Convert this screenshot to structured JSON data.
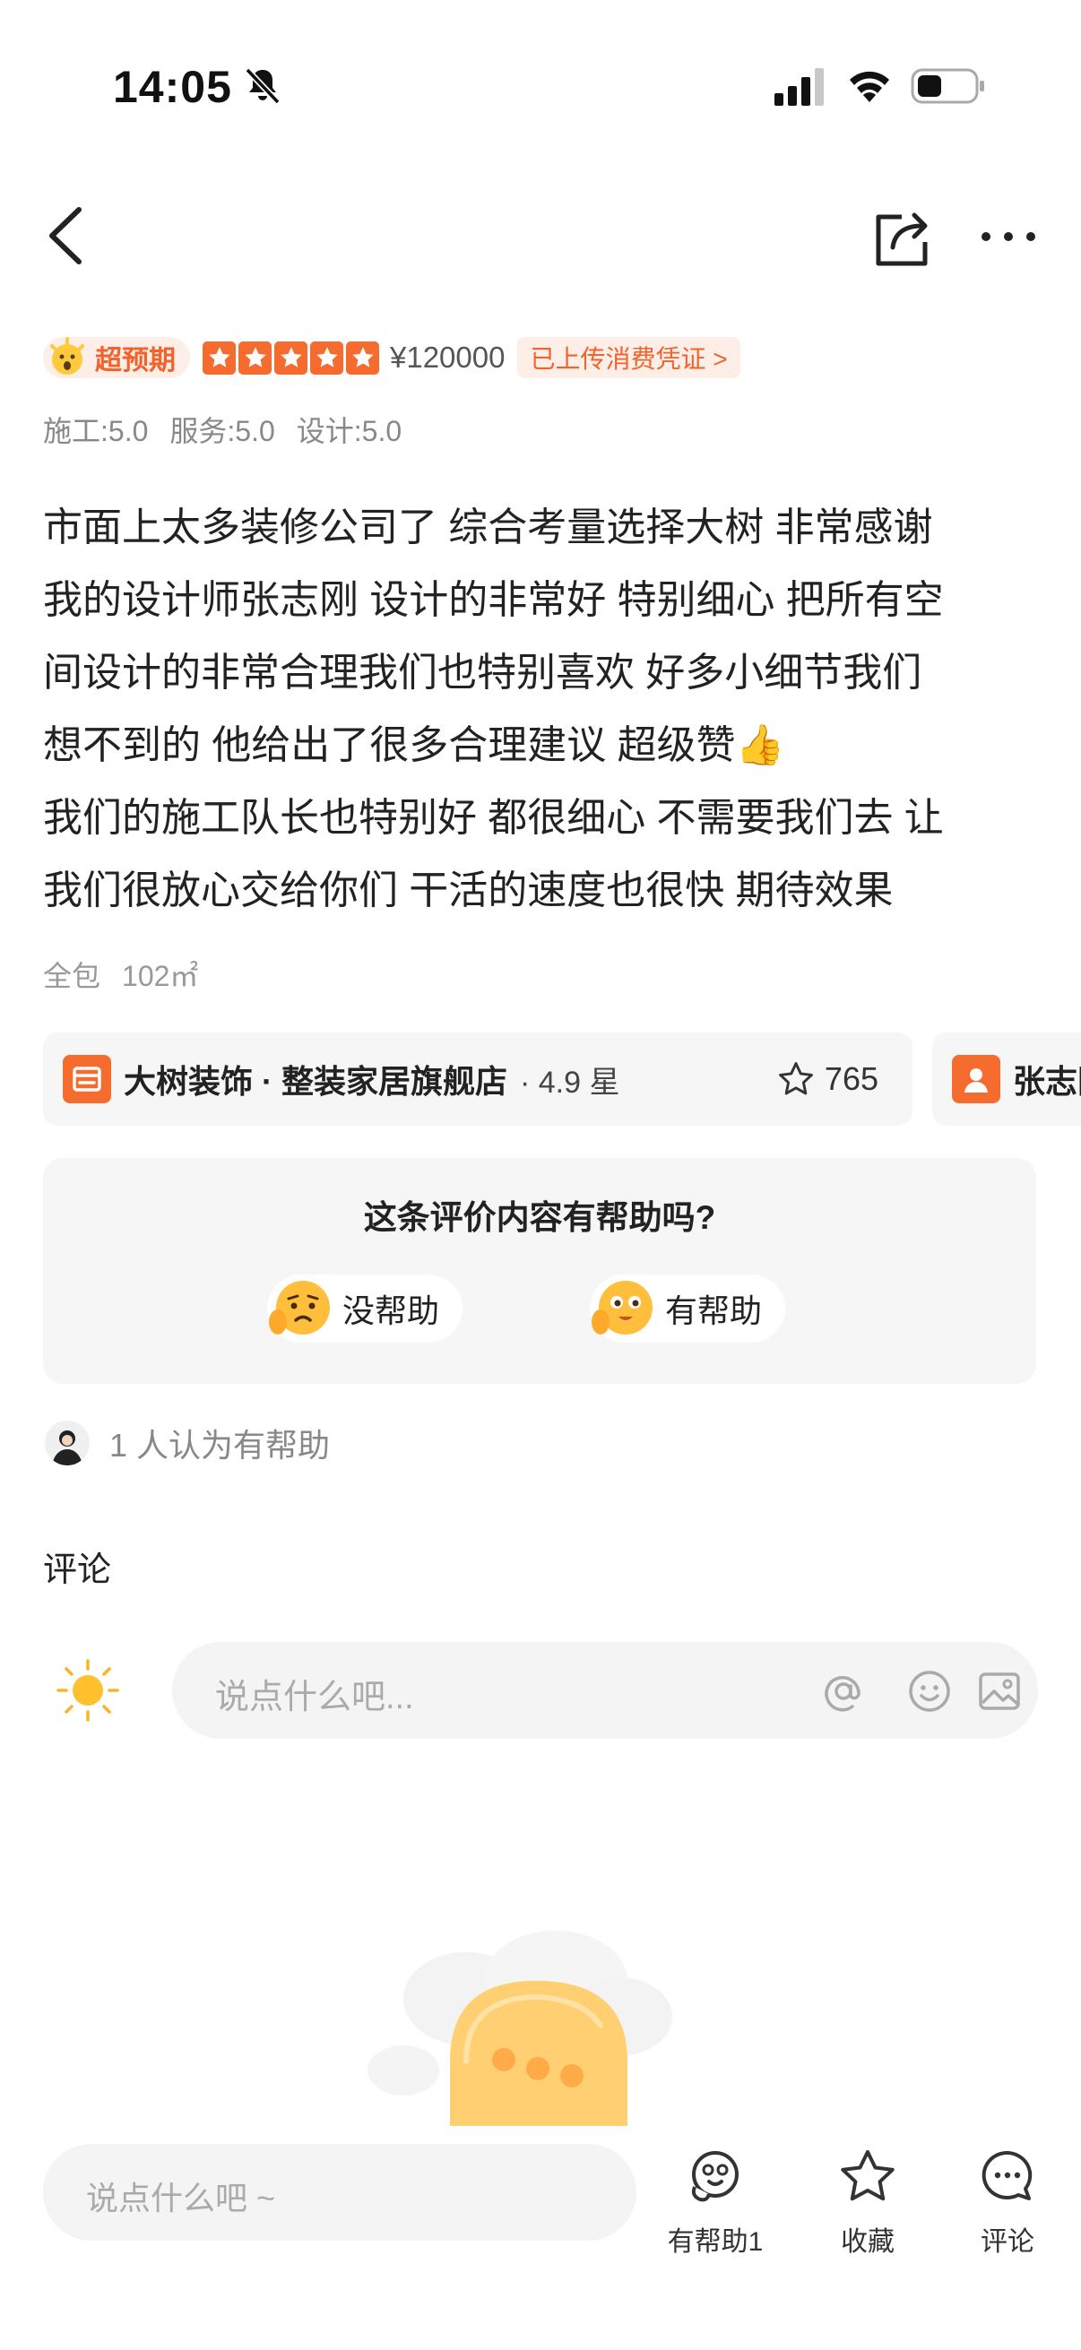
{
  "status_bar": {
    "time": "14:05"
  },
  "review": {
    "badge_label": "超预期",
    "stars": 5,
    "price": "¥120000",
    "receipt_label": "已上传消费凭证 >",
    "scores": [
      "施工:5.0",
      "服务:5.0",
      "设计:5.0"
    ],
    "lines": [
      "市面上太多装修公司了 综合考量选择大树 非常感谢",
      "我的设计师张志刚 设计的非常好 特别细心 把所有空",
      "间设计的非常合理我们也特别喜欢  好多小细节我们",
      "想不到的 他给出了很多合理建议 超级赞👍",
      "我们的施工队长也特别好 都很细心 不需要我们去 让",
      "我们很放心交给你们 干活的速度也很快 期待效果"
    ],
    "package_type": "全包",
    "area": "102㎡"
  },
  "store_chip": {
    "name": "大树装饰 · 整装家居旗舰店",
    "rating": "· 4.9 星",
    "favorites": "765"
  },
  "designer_chip": {
    "name": "张志刚"
  },
  "helpful_poll": {
    "question": "这条评价内容有帮助吗?",
    "no_label": "没帮助",
    "yes_label": "有帮助"
  },
  "helped_summary": "1  人认为有帮助",
  "comments": {
    "title": "评论",
    "input_placeholder": "说点什么吧..."
  },
  "bottom_bar": {
    "input_placeholder": "说点什么吧 ~",
    "helpful_label": "有帮助1",
    "favorite_label": "收藏",
    "comment_label": "评论"
  },
  "colors": {
    "accent": "#f66b2e",
    "badge_bg": "#fdeee8"
  }
}
